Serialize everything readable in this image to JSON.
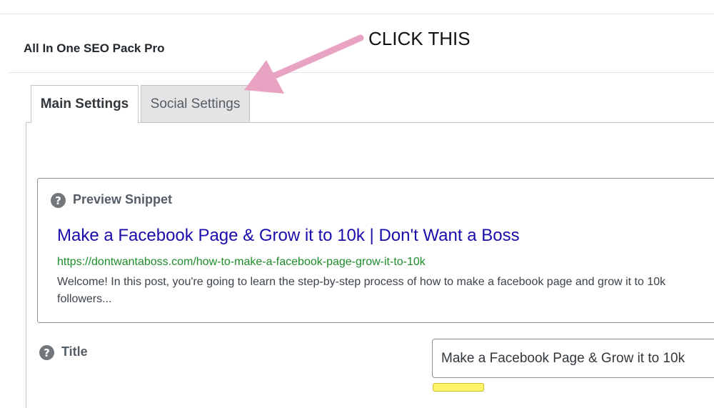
{
  "header": {
    "title": "All In One SEO Pack Pro"
  },
  "tabs": [
    {
      "label": "Main Settings",
      "active": true
    },
    {
      "label": "Social Settings",
      "active": false
    }
  ],
  "annotation": {
    "text": "CLICK THIS",
    "arrow_color": "#e9a3c2"
  },
  "snippet": {
    "label": "Preview Snippet",
    "help_icon": "?",
    "headline": "Make a Facebook Page & Grow it to 10k | Don't Want a Boss",
    "url": "https://dontwantaboss.com/how-to-make-a-facebook-page-grow-it-to-10k",
    "description": "Welcome! In this post, you're going to learn the step-by-step process of how to make a facebook page and grow it to 10k followers..."
  },
  "title_field": {
    "label": "Title",
    "help_icon": "?",
    "value": "Make a Facebook Page & Grow it to 10k"
  },
  "colors": {
    "headline_link": "#1a0dab",
    "url_green": "#1e8c2a",
    "counter_badge": "#fff36a"
  }
}
